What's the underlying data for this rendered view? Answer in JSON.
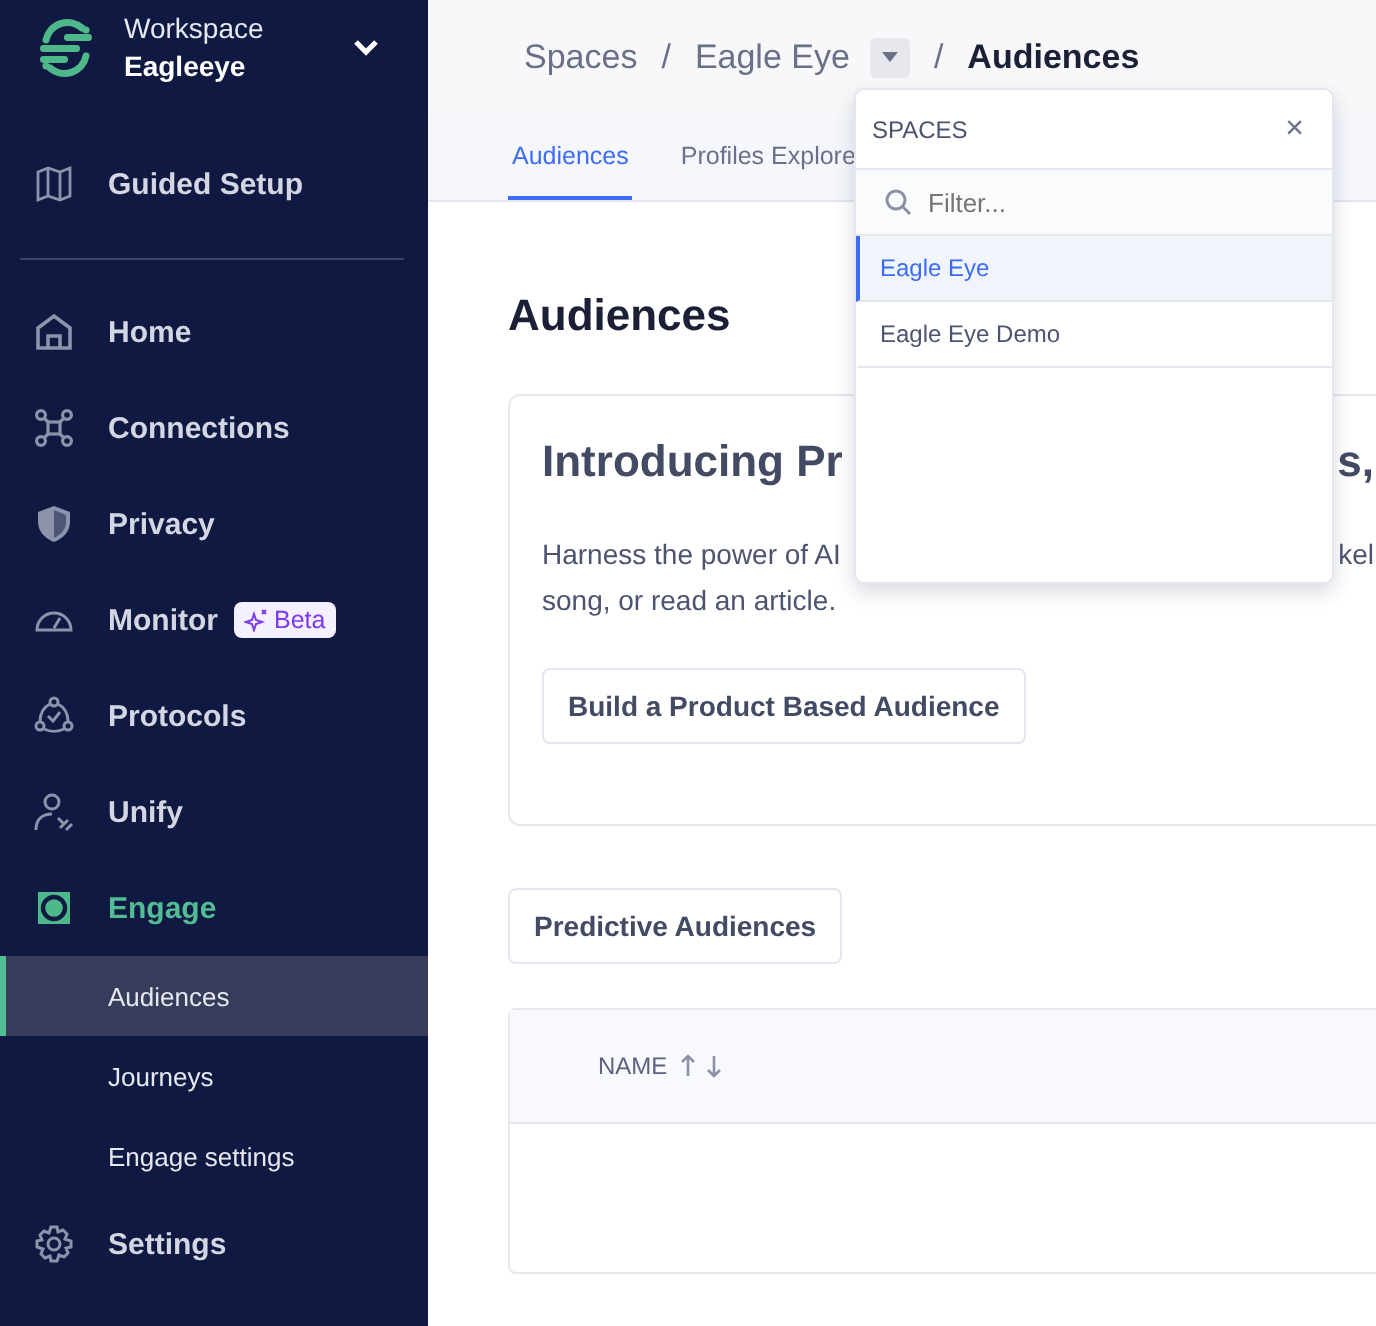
{
  "workspace": {
    "label": "Workspace",
    "name": "Eagleeye"
  },
  "guided_setup": {
    "label": "Guided Setup"
  },
  "nav": [
    {
      "label": "Home",
      "selected": false
    },
    {
      "label": "Connections",
      "selected": false
    },
    {
      "label": "Privacy",
      "selected": false
    },
    {
      "label": "Monitor",
      "selected": false,
      "badge": "Beta"
    },
    {
      "label": "Protocols",
      "selected": false
    },
    {
      "label": "Unify",
      "selected": false
    },
    {
      "label": "Engage",
      "selected": true,
      "children": [
        {
          "label": "Audiences",
          "selected": true
        },
        {
          "label": "Journeys",
          "selected": false
        },
        {
          "label": "Engage settings",
          "selected": false
        }
      ]
    },
    {
      "label": "Settings",
      "selected": false
    }
  ],
  "breadcrumbs": [
    "Spaces",
    "Eagle Eye",
    "Audiences"
  ],
  "breadcrumb_separators": [
    "/",
    "/"
  ],
  "tabs": [
    {
      "label": "Audiences",
      "selected": true
    },
    {
      "label": "Profiles Explore",
      "selected": false
    }
  ],
  "page_title": "Audiences",
  "card": {
    "title_left": "Introducing Pr",
    "title_right": "s,",
    "text_left": "Harness the power of AI",
    "text_right": "kel",
    "text_line2": "song, or read an article.",
    "button": "Build a Product Based Audience"
  },
  "predictive_button": "Predictive Audiences",
  "table": {
    "columns": [
      "NAME"
    ]
  },
  "dropdown": {
    "title": "SPACES",
    "close": "×",
    "filter_placeholder": "Filter...",
    "items": [
      {
        "label": "Eagle Eye",
        "selected": true
      },
      {
        "label": "Eagle Eye Demo",
        "selected": false
      }
    ]
  }
}
